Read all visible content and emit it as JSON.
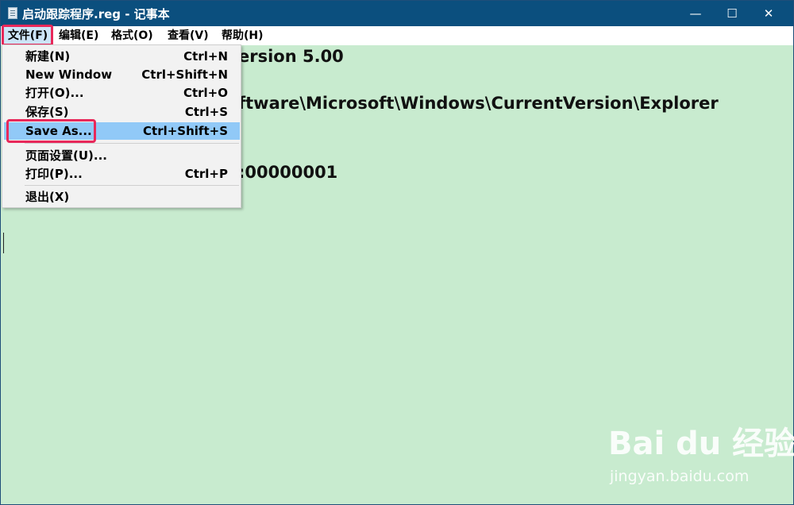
{
  "window": {
    "title": "启动跟踪程序.reg - 记事本",
    "controls": {
      "minimize": "—",
      "maximize": "☐",
      "close": "✕"
    }
  },
  "menubar": {
    "items": [
      "文件(F)",
      "编辑(E)",
      "格式(O)",
      "查看(V)",
      "帮助(H)"
    ]
  },
  "file_menu": {
    "items": [
      {
        "label": "新建(N)",
        "shortcut": "Ctrl+N"
      },
      {
        "label": "New Window",
        "shortcut": "Ctrl+Shift+N"
      },
      {
        "label": "打开(O)...",
        "shortcut": "Ctrl+O"
      },
      {
        "label": "保存(S)",
        "shortcut": "Ctrl+S"
      },
      {
        "label": "Save As...",
        "shortcut": "Ctrl+Shift+S"
      },
      {
        "label": "页面设置(U)...",
        "shortcut": ""
      },
      {
        "label": "打印(P)...",
        "shortcut": "Ctrl+P"
      },
      {
        "label": "退出(X)",
        "shortcut": ""
      }
    ],
    "highlighted": "Save As..."
  },
  "editor": {
    "visible_lines": [
      "ersion 5.00",
      "ftware\\Microsoft\\Windows\\CurrentVersion\\Explorer",
      ":00000001"
    ]
  },
  "watermark": {
    "logo": "Bai du 经验",
    "url": "jingyan.baidu.com"
  },
  "colors": {
    "titlebar": "#0b4f7e",
    "editor_bg": "#c8ebcf",
    "menu_highlight": "#91c9f7",
    "annotation": "#e8285a"
  }
}
